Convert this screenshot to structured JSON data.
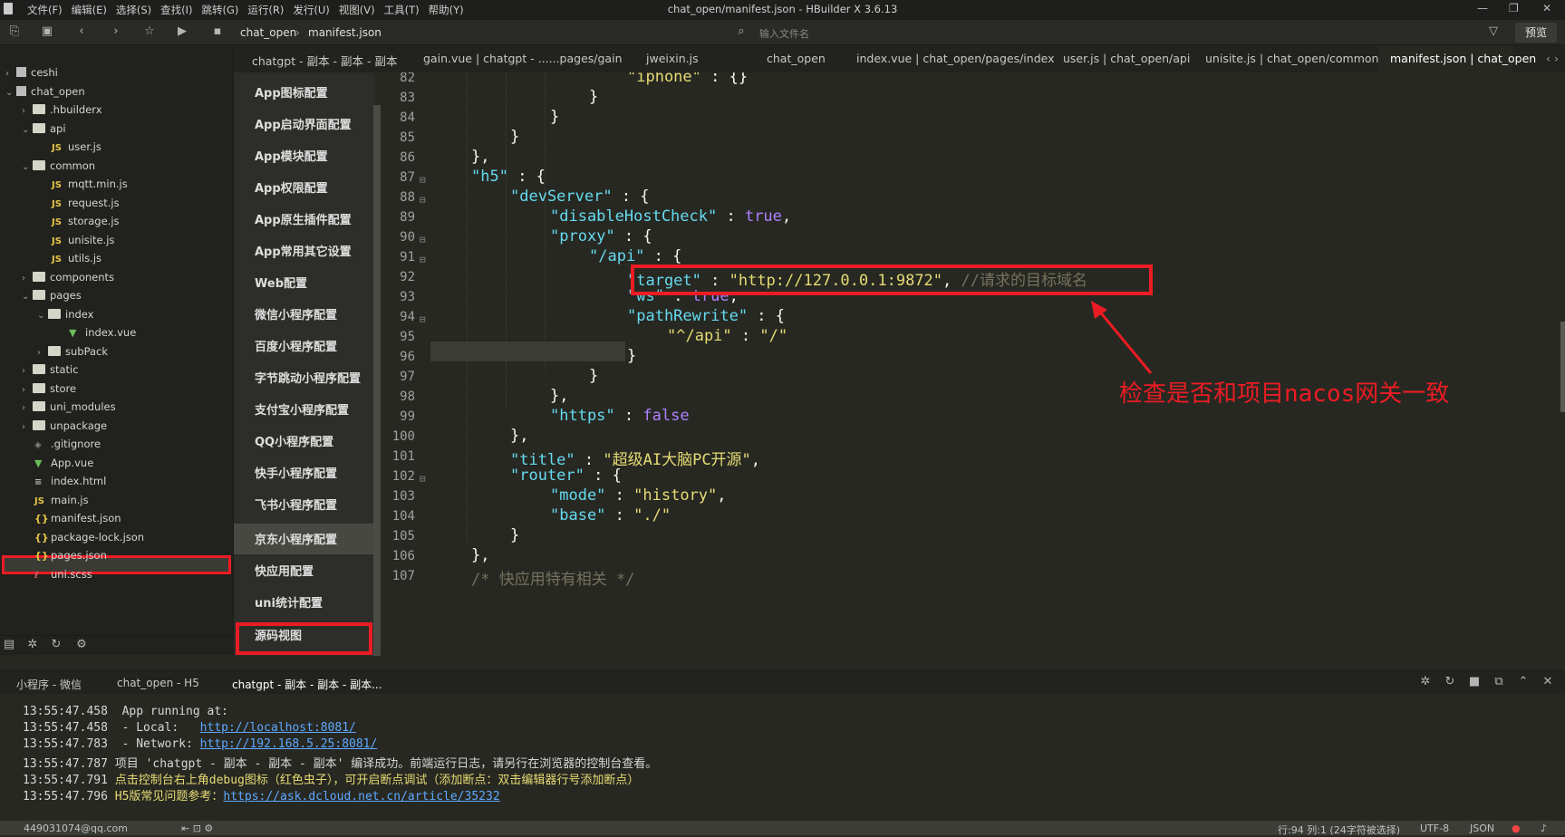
{
  "titlebar": {
    "menus": [
      "文件(F)",
      "编辑(E)",
      "选择(S)",
      "查找(I)",
      "跳转(G)",
      "运行(R)",
      "发行(U)",
      "视图(V)",
      "工具(T)",
      "帮助(Y)"
    ],
    "title": "chat_open/manifest.json - HBuilder X 3.6.13"
  },
  "toolbar": {
    "breadcrumb": [
      "chat_open",
      "manifest.json"
    ],
    "search_placeholder": "输入文件名",
    "preview_label": "预览"
  },
  "tabs": [
    {
      "label": "chatgpt - 副本 - 副本 - 副本"
    },
    {
      "label": "gain.vue | chatgpt - ......pages/gain"
    },
    {
      "label": "jweixin.js"
    },
    {
      "label": "chat_open"
    },
    {
      "label": "index.vue | chat_open/pages/index"
    },
    {
      "label": "user.js | chat_open/api"
    },
    {
      "label": "unisite.js | chat_open/common"
    },
    {
      "label": "manifest.json | chat_open"
    }
  ],
  "tree": [
    {
      "label": "ceshi",
      "type": "project"
    },
    {
      "label": "chat_open",
      "type": "project"
    },
    {
      "label": ".hbuilderx",
      "type": "folder"
    },
    {
      "label": "api",
      "type": "folder"
    },
    {
      "label": "user.js",
      "type": "js"
    },
    {
      "label": "common",
      "type": "folder"
    },
    {
      "label": "mqtt.min.js",
      "type": "js"
    },
    {
      "label": "request.js",
      "type": "js"
    },
    {
      "label": "storage.js",
      "type": "js"
    },
    {
      "label": "unisite.js",
      "type": "js"
    },
    {
      "label": "utils.js",
      "type": "js"
    },
    {
      "label": "components",
      "type": "folder"
    },
    {
      "label": "pages",
      "type": "folder"
    },
    {
      "label": "index",
      "type": "folder"
    },
    {
      "label": "index.vue",
      "type": "vue"
    },
    {
      "label": "subPack",
      "type": "folder"
    },
    {
      "label": "static",
      "type": "folder"
    },
    {
      "label": "store",
      "type": "folder"
    },
    {
      "label": "uni_modules",
      "type": "folder"
    },
    {
      "label": "unpackage",
      "type": "folder"
    },
    {
      "label": ".gitignore",
      "type": "file"
    },
    {
      "label": "App.vue",
      "type": "vue"
    },
    {
      "label": "index.html",
      "type": "file"
    },
    {
      "label": "main.js",
      "type": "js"
    },
    {
      "label": "manifest.json",
      "type": "json"
    },
    {
      "label": "package-lock.json",
      "type": "json"
    },
    {
      "label": "pages.json",
      "type": "json"
    },
    {
      "label": "uni.scss",
      "type": "file"
    }
  ],
  "config_menu": [
    "App图标配置",
    "App启动界面配置",
    "App模块配置",
    "App权限配置",
    "App原生插件配置",
    "App常用其它设置",
    "Web配置",
    "微信小程序配置",
    "百度小程序配置",
    "字节跳动小程序配置",
    "支付宝小程序配置",
    "QQ小程序配置",
    "快手小程序配置",
    "飞书小程序配置",
    "京东小程序配置",
    "快应用配置",
    "uni统计配置",
    "源码视图"
  ],
  "code": {
    "line_numbers": [
      "82",
      "83",
      "84",
      "85",
      "86",
      "87",
      "88",
      "89",
      "90",
      "91",
      "92",
      "93",
      "94",
      "95",
      "96",
      "97",
      "98",
      "99",
      "100",
      "101",
      "102",
      "103",
      "104",
      "105",
      "106",
      "107"
    ],
    "l82_key": "\"iphone\"",
    "l82_rest": " : {}",
    "l83": "}",
    "l84": "}",
    "l85": "}",
    "l86": "},",
    "l87_key": "\"h5\"",
    "l87_rest": " : {",
    "l88_key": "\"devServer\"",
    "l88_rest": " : {",
    "l89_key": "\"disableHostCheck\"",
    "l89_sep": " : ",
    "l89_val": "true",
    "l89_end": ",",
    "l90_key": "\"proxy\"",
    "l90_rest": " : {",
    "l91_key": "\"/api\"",
    "l91_rest": " : {",
    "l92_key": "\"target\"",
    "l92_sep": " : ",
    "l92_val": "\"http://127.0.0.1:9872\"",
    "l92_comma": ", ",
    "l92_comment": "//请求的目标域名",
    "l93_key": "\"ws\"",
    "l93_sep": " : ",
    "l93_val": "true",
    "l93_end": ",",
    "l94_key": "\"pathRewrite\"",
    "l94_rest": " : {",
    "l95_key": "\"^/api\"",
    "l95_sep": " : ",
    "l95_val": "\"/\"",
    "l96": "}",
    "l97": "}",
    "l98": "},",
    "l99_key": "\"https\"",
    "l99_sep": " : ",
    "l99_val": "false",
    "l100": "},",
    "l101_key": "\"title\"",
    "l101_sep": " : ",
    "l101_val": "\"超级AI大脑PC开源\"",
    "l101_end": ",",
    "l102_key": "\"router\"",
    "l102_rest": " : {",
    "l103_key": "\"mode\"",
    "l103_sep": " : ",
    "l103_val": "\"history\"",
    "l103_end": ",",
    "l104_key": "\"base\"",
    "l104_sep": " : ",
    "l104_val": "\"./\"",
    "l105": "}",
    "l106": "},",
    "l107": "/* 快应用特有相关 */"
  },
  "annotation": "检查是否和项目nacos网关一致",
  "panel_tabs": [
    "小程序 - 微信",
    "chat_open - H5",
    "chatgpt - 副本 - 副本 - 副本..."
  ],
  "console": {
    "l1_time": "13:55:47.458",
    "l1_text": "  App running at:",
    "l2_time": "13:55:47.458",
    "l2_text": "  - Local:   ",
    "l2_link": "http://localhost:8081/",
    "l3_time": "13:55:47.783",
    "l3_text": "  - Network: ",
    "l3_link": "http://192.168.5.25:8081/",
    "l4_time": "13:55:47.787",
    "l4_text": " 项目 'chatgpt - 副本 - 副本 - 副本' 编译成功。前端运行日志，请另行在浏览器的控制台查看。",
    "l5_time": "13:55:47.791",
    "l5_text": " 点击控制台右上角debug图标（红色虫子），可开启断点调试（添加断点：双击编辑器行号添加断点）",
    "l6_time": "13:55:47.796",
    "l6_text": " H5版常见问题参考：",
    "l6_link": "https://ask.dcloud.net.cn/article/35232"
  },
  "status": {
    "account": "449031074@qq.com",
    "position": "行:94  列:1 (24字符被选择)",
    "encoding": "UTF-8",
    "language": "JSON"
  },
  "colors": {
    "annotation_red": "#ec1c24",
    "string": "#e6db74",
    "key_cyan": "#66d9ef",
    "bool_purple": "#ae81ff"
  }
}
